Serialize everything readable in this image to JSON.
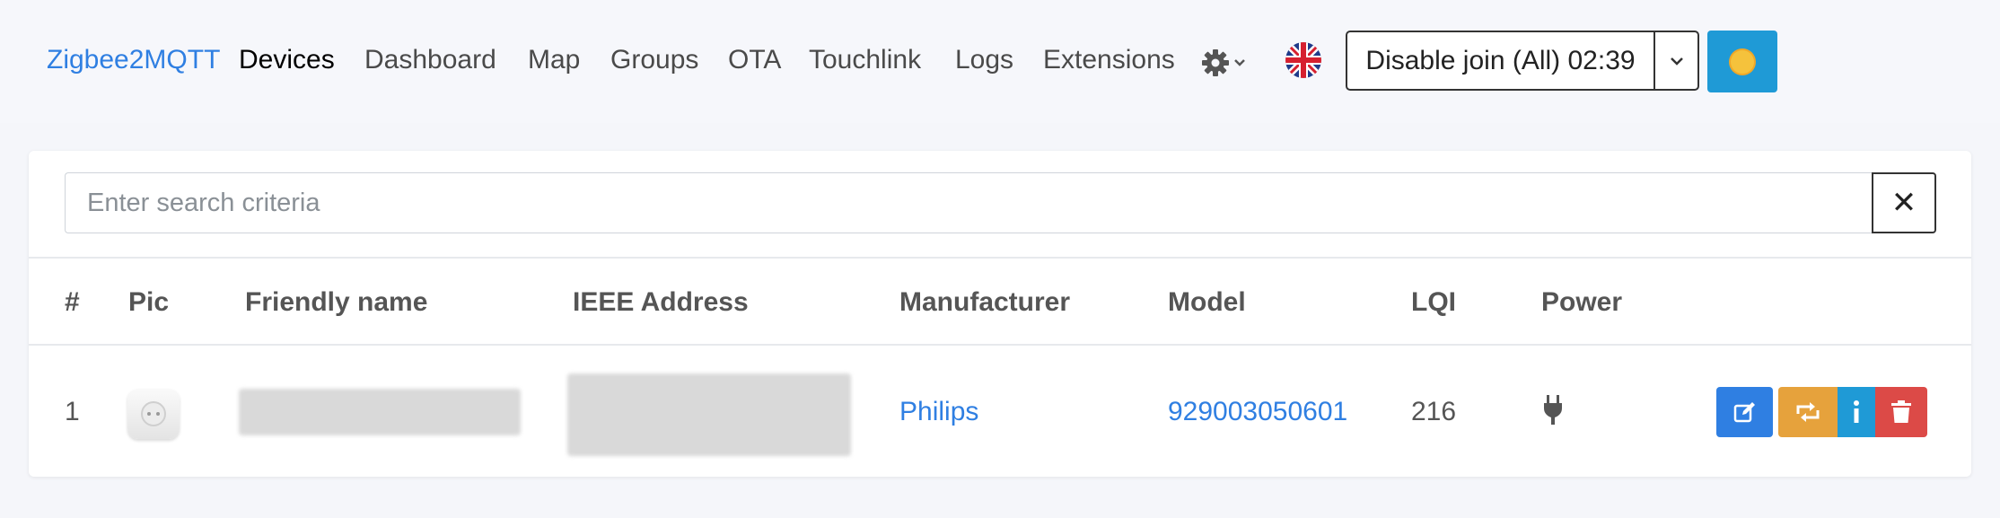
{
  "nav": {
    "brand": "Zigbee2MQTT",
    "links": [
      "Devices",
      "Dashboard",
      "Map",
      "Groups",
      "OTA",
      "Touchlink",
      "Logs",
      "Extensions"
    ],
    "active": "Devices",
    "settings_icon": "gear-icon",
    "language_icon": "uk-flag-icon",
    "join_button_label": "Disable join (All) 02:39",
    "theme_icon": "sun-icon"
  },
  "search": {
    "placeholder": "Enter search criteria",
    "value": "",
    "clear_label": "✕"
  },
  "table": {
    "headers": [
      "#",
      "Pic",
      "Friendly name",
      "IEEE Address",
      "Manufacturer",
      "Model",
      "LQI",
      "Power"
    ],
    "rows": [
      {
        "index": "1",
        "picture": "smart-plug-image",
        "friendly_name": "",
        "ieee_address": "",
        "manufacturer": "Philips",
        "model": "929003050601",
        "lqi": "216",
        "power": "plug-icon"
      }
    ],
    "row_actions": [
      "edit-icon",
      "reconfigure-icon",
      "info-icon",
      "delete-icon"
    ]
  },
  "colors": {
    "brand_blue": "#2f7fe2",
    "info_blue": "#1f9ad6",
    "warning_orange": "#e6a23c",
    "danger_red": "#dc4a47"
  }
}
